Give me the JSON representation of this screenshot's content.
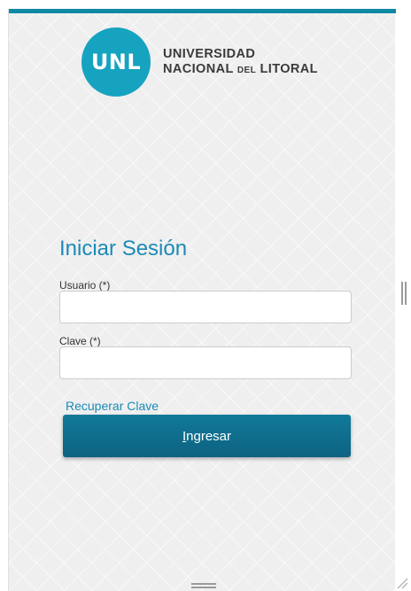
{
  "logo": {
    "abbr": "UNL",
    "line1": "UNIVERSIDAD",
    "line2_a": "NACIONAL ",
    "line2_b": "DEL",
    "line2_c": " LITORAL"
  },
  "login": {
    "title": "Iniciar Sesión",
    "user_label": "Usuario (*)",
    "user_value": "",
    "pass_label": "Clave (*)",
    "pass_value": "",
    "recover_link": "Recuperar Clave",
    "submit_first": "I",
    "submit_rest": "ngresar"
  },
  "colors": {
    "accent": "#0f8aa5",
    "title": "#1b8ab6",
    "button": "#0d6281",
    "logo_circle": "#16a3c0"
  }
}
